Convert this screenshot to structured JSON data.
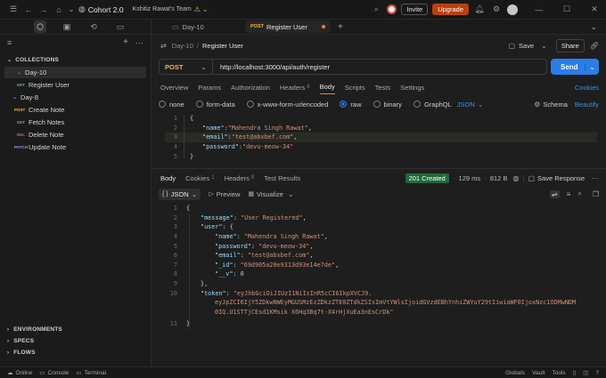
{
  "titlebar": {
    "app_name": "Cohort 2.0",
    "team_name": "Kshitiz Rawat's Team",
    "invite_label": "Invite",
    "upgrade_label": "Upgrade"
  },
  "tabs": [
    {
      "label": "Day-10"
    },
    {
      "method": "POST",
      "label": "Register User"
    }
  ],
  "sidebar": {
    "collections_label": "COLLECTIONS",
    "folders": [
      {
        "name": "Day-10",
        "requests": [
          {
            "method": "GET",
            "name": "Register User"
          }
        ]
      },
      {
        "name": "Day-8",
        "requests": [
          {
            "method": "POST",
            "name": "Create Note"
          },
          {
            "method": "GET",
            "name": "Fetch Notes"
          },
          {
            "method": "DEL",
            "name": "Delete Note"
          },
          {
            "method": "PATCH",
            "name": "Update Note"
          }
        ]
      }
    ],
    "bottom_sections": [
      "ENVIRONMENTS",
      "SPECS",
      "FLOWS"
    ]
  },
  "request": {
    "breadcrumb_folder": "Day-10",
    "breadcrumb_name": "Register User",
    "save_label": "Save",
    "share_label": "Share",
    "method": "POST",
    "url": "http://localhost:3000/api/auth/register",
    "send_label": "Send",
    "cookies_label": "Cookies",
    "section_tabs": [
      {
        "label": "Overview"
      },
      {
        "label": "Params"
      },
      {
        "label": "Authorization"
      },
      {
        "label": "Headers",
        "badge": "8"
      },
      {
        "label": "Body"
      },
      {
        "label": "Scripts"
      },
      {
        "label": "Tests"
      },
      {
        "label": "Settings"
      }
    ],
    "body_types": [
      "none",
      "form-data",
      "x-www-form-urlencoded",
      "raw",
      "binary",
      "GraphQL"
    ],
    "body_format": "JSON",
    "schema_label": "Schema",
    "beautify_label": "Beautify",
    "body_lines": [
      {
        "n": "1",
        "text": "{"
      },
      {
        "n": "2",
        "key": "\"name\"",
        "val": "\"Mahendra Singh Rawat\"",
        "end": ","
      },
      {
        "n": "3",
        "key": "\"email\"",
        "val": "\"test@abxbef.com\"",
        "end": ","
      },
      {
        "n": "4",
        "key": "\"password\"",
        "val": "\"devu-meow-34\"",
        "end": ""
      },
      {
        "n": "5",
        "text": "}"
      }
    ]
  },
  "response": {
    "tabs": [
      {
        "label": "Body"
      },
      {
        "label": "Cookies",
        "badge": "1"
      },
      {
        "label": "Headers",
        "badge": "8"
      },
      {
        "label": "Test Results"
      }
    ],
    "status": "201 Created",
    "time": "129 ms",
    "size": "812 B",
    "save_response_label": "Save Response",
    "format": "JSON",
    "preview_label": "Preview",
    "visualize_label": "Visualize",
    "lines": [
      {
        "n": "1",
        "indent": 0,
        "text": "{"
      },
      {
        "n": "2",
        "indent": 1,
        "key": "\"message\"",
        "val": "\"User Registered\"",
        "end": ","
      },
      {
        "n": "3",
        "indent": 1,
        "key": "\"user\"",
        "text": "{"
      },
      {
        "n": "4",
        "indent": 2,
        "key": "\"name\"",
        "val": "\"Mahendra Singh Rawat\"",
        "end": ","
      },
      {
        "n": "5",
        "indent": 2,
        "key": "\"password\"",
        "val": "\"devu-meow-34\"",
        "end": ","
      },
      {
        "n": "6",
        "indent": 2,
        "key": "\"email\"",
        "val": "\"test@abxbef.com\"",
        "end": ","
      },
      {
        "n": "7",
        "indent": 2,
        "key": "\"_id\"",
        "val": "\"69d905a20e9313d93e14e7de\"",
        "end": ","
      },
      {
        "n": "8",
        "indent": 2,
        "key": "\"__v\"",
        "num": "0"
      },
      {
        "n": "9",
        "indent": 1,
        "text": "},"
      },
      {
        "n": "10",
        "indent": 1,
        "key": "\"token\"",
        "val": "\"eyJhbGciOiJIUzI1NiIsInR5cCI6IkpXVCJ9."
      },
      {
        "n": "",
        "indent": 2,
        "val": "eyJpZCI6IjY5ZDkwNWEyMGUSMzEzZDkzZTE0ZTdkZSIsImVtYWlsIjoidGVzdEBhYnhiZWYuY29tIiwiaWF0IjoxNzc1ODMwNDM"
      },
      {
        "n": "",
        "indent": 2,
        "val": "0IQ.U1STTjCEsd1KMsik X6Hq3Bq7t-X4rHjXuEa3nEsCrDk\""
      },
      {
        "n": "11",
        "indent": 0,
        "text": "}"
      }
    ]
  },
  "statusbar": {
    "online": "Online",
    "console": "Console",
    "terminal": "Terminal",
    "globals": "Globals",
    "vault": "Vault",
    "tools": "Tools"
  }
}
